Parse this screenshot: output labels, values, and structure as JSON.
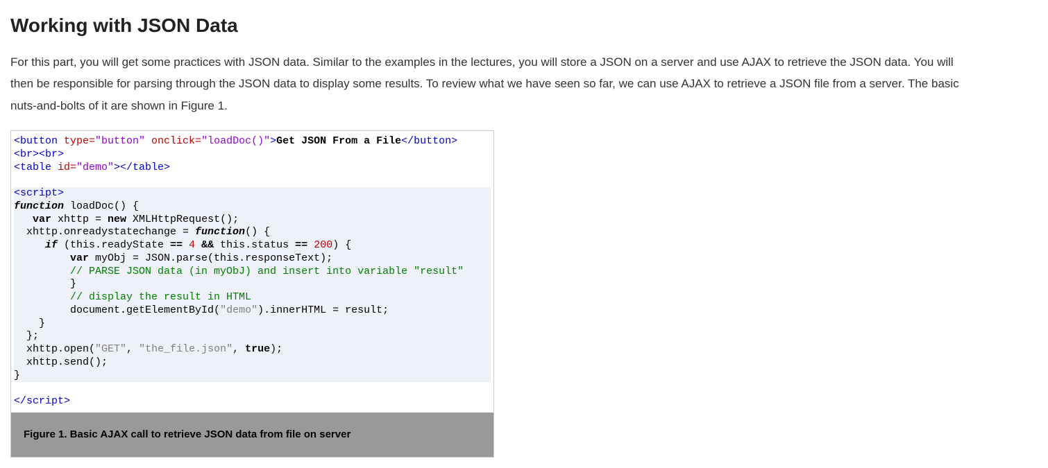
{
  "heading": "Working with JSON Data",
  "intro": "For this part, you will get some practices with JSON data. Similar to the examples in the lectures, you will store a JSON on a server and use AJAX to retrieve the JSON data. You will then be responsible for parsing through the JSON data to display some results. To review what we have seen so far, we can use AJAX to retrieve a JSON file from a server. The basic nuts-and-bolts of it are shown in Figure 1.",
  "caption": "Figure 1. Basic AJAX call to retrieve JSON data from file on server",
  "code": {
    "l1_btn_open": "<button",
    "l1_type_attr": " type=",
    "l1_type_val": "\"button\"",
    "l1_onclick_attr": " onclick=",
    "l1_onclick_val": "\"loadDoc()\"",
    "l1_close": ">",
    "l1_text": "Get JSON From a File",
    "l1_end": "</button>",
    "l2": "<br><br>",
    "l3_open": "<table",
    "l3_id_attr": " id=",
    "l3_id_val": "\"demo\"",
    "l3_close": "></table>",
    "l5": "<script>",
    "l6_fn": "function",
    "l6_rest": " loadDoc() {",
    "l7_var": "   var",
    "l7_rest1": " xhttp = ",
    "l7_new": "new",
    "l7_rest2": " XMLHttpRequest();",
    "l8": "  xhttp.onreadystatechange = ",
    "l8_fn": "function",
    "l8_rest": "() {",
    "l9_if": "     if",
    "l9_rest1": " (this.readyState ",
    "l9_eq1": "==",
    "l9_sp1": " ",
    "l9_n1": "4",
    "l9_sp2": " ",
    "l9_and": "&&",
    "l9_rest2": " this.status ",
    "l9_eq2": "==",
    "l9_sp3": " ",
    "l9_n2": "200",
    "l9_rest3": ") {",
    "l10_var": "         var",
    "l10_rest": " myObj = JSON.parse(this.responseText);",
    "l11": "         // PARSE JSON data (in myObJ) and insert into variable \"result\"",
    "l12": "         }",
    "l13": "         // display the result in HTML",
    "l14a": "         document.getElementById(",
    "l14q": "\"demo\"",
    "l14b": ").innerHTML = result;",
    "l15": "    }",
    "l16": "  };",
    "l17a": "  xhttp.open(",
    "l17s1": "\"GET\"",
    "l17b": ", ",
    "l17s2": "\"the_file.json\"",
    "l17c": ", ",
    "l17t": "true",
    "l17d": ");",
    "l18": "  xhttp.send();",
    "l19": "}",
    "l21_close": "/script>"
  }
}
